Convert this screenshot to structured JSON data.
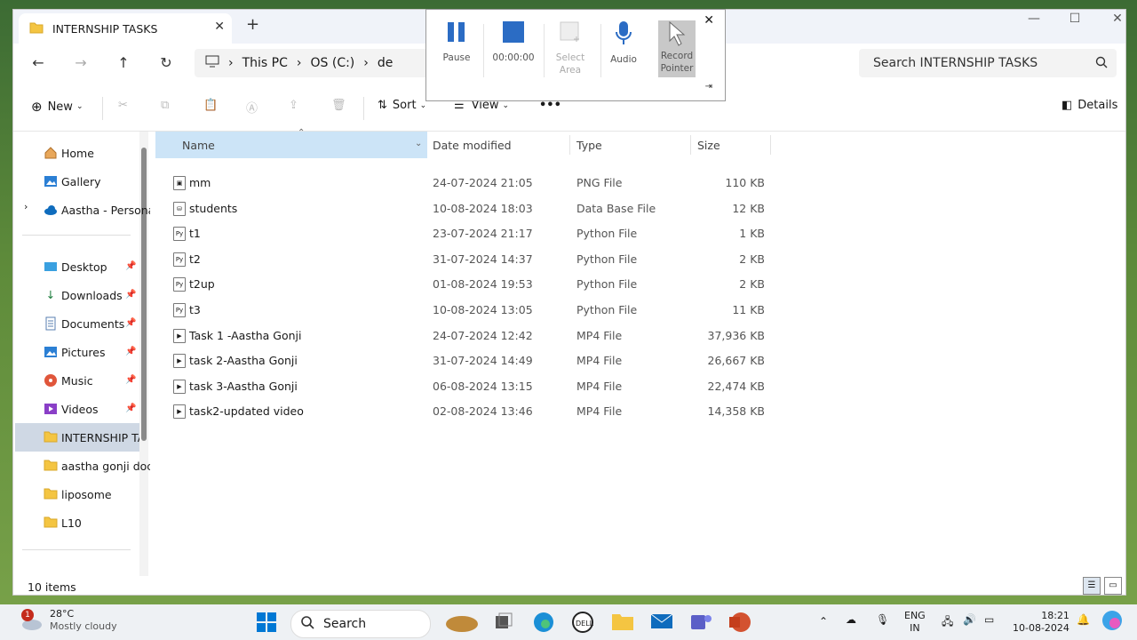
{
  "tab": {
    "title": "INTERNSHIP TASKS"
  },
  "address": {
    "segments": [
      "This PC",
      "OS (C:)",
      "de"
    ]
  },
  "search": {
    "placeholder": "Search INTERNSHIP TASKS"
  },
  "commands": {
    "new": "New",
    "sort": "Sort",
    "view": "View",
    "more": "•••",
    "details": "Details"
  },
  "sidebar": {
    "items": [
      {
        "label": "Home",
        "icon": "home-icon"
      },
      {
        "label": "Gallery",
        "icon": "gallery-icon"
      },
      {
        "label": "Aastha - Persona",
        "icon": "onedrive-icon"
      },
      {
        "label": "Desktop",
        "icon": "desktop-icon",
        "pinned": true
      },
      {
        "label": "Downloads",
        "icon": "download-icon",
        "pinned": true
      },
      {
        "label": "Documents",
        "icon": "documents-icon",
        "pinned": true
      },
      {
        "label": "Pictures",
        "icon": "pictures-icon",
        "pinned": true
      },
      {
        "label": "Music",
        "icon": "music-icon",
        "pinned": true
      },
      {
        "label": "Videos",
        "icon": "videos-icon",
        "pinned": true
      },
      {
        "label": "INTERNSHIP TAS",
        "icon": "folder-icon",
        "active": true
      },
      {
        "label": "aastha gonji doc",
        "icon": "folder-icon"
      },
      {
        "label": "liposome",
        "icon": "folder-icon"
      },
      {
        "label": "L10",
        "icon": "folder-icon"
      }
    ]
  },
  "columns": {
    "name": "Name",
    "date": "Date modified",
    "type": "Type",
    "size": "Size"
  },
  "files": [
    {
      "name": "mm",
      "date": "24-07-2024 21:05",
      "type": "PNG File",
      "size": "110 KB",
      "icon": "image-file-icon"
    },
    {
      "name": "students",
      "date": "10-08-2024 18:03",
      "type": "Data Base File",
      "size": "12 KB",
      "icon": "database-file-icon"
    },
    {
      "name": "t1",
      "date": "23-07-2024 21:17",
      "type": "Python File",
      "size": "1 KB",
      "icon": "python-file-icon"
    },
    {
      "name": "t2",
      "date": "31-07-2024 14:37",
      "type": "Python File",
      "size": "2 KB",
      "icon": "python-file-icon"
    },
    {
      "name": "t2up",
      "date": "01-08-2024 19:53",
      "type": "Python File",
      "size": "2 KB",
      "icon": "python-file-icon"
    },
    {
      "name": "t3",
      "date": "10-08-2024 13:05",
      "type": "Python File",
      "size": "11 KB",
      "icon": "python-file-icon"
    },
    {
      "name": "Task 1 -Aastha Gonji",
      "date": "24-07-2024 12:42",
      "type": "MP4 File",
      "size": "37,936 KB",
      "icon": "video-file-icon"
    },
    {
      "name": "task 2-Aastha Gonji",
      "date": "31-07-2024 14:49",
      "type": "MP4 File",
      "size": "26,667 KB",
      "icon": "video-file-icon"
    },
    {
      "name": "task 3-Aastha Gonji",
      "date": "06-08-2024 13:15",
      "type": "MP4 File",
      "size": "22,474 KB",
      "icon": "video-file-icon"
    },
    {
      "name": "task2-updated video",
      "date": "02-08-2024 13:46",
      "type": "MP4 File",
      "size": "14,358 KB",
      "icon": "video-file-icon"
    }
  ],
  "status": {
    "items": "10 items"
  },
  "recorder": {
    "pause": "Pause",
    "time": "00:00:00",
    "select_area_1": "Select",
    "select_area_2": "Area",
    "audio": "Audio",
    "record_pointer_1": "Record",
    "record_pointer_2": "Pointer"
  },
  "taskbar": {
    "weather_temp": "28°C",
    "weather_desc": "Mostly cloudy",
    "weather_badge": "1",
    "search": "Search",
    "lang_1": "ENG",
    "lang_2": "IN",
    "time": "18:21",
    "date": "10-08-2024"
  },
  "colors": {
    "accent": "#0067c0",
    "selection": "#cce4f7",
    "folder": "#f4c542"
  }
}
